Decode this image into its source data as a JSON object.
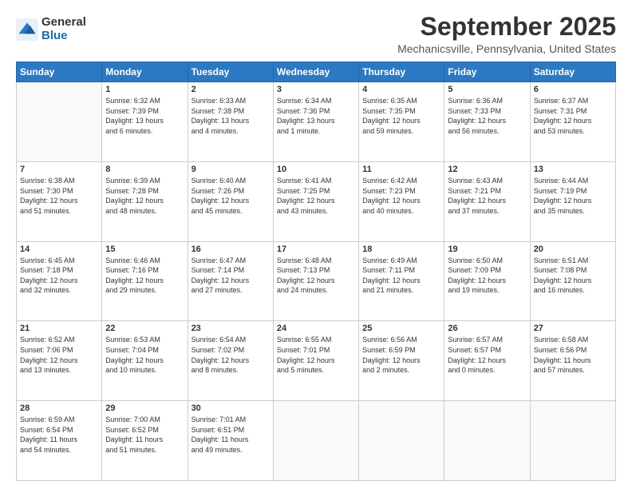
{
  "logo": {
    "general": "General",
    "blue": "Blue"
  },
  "title": {
    "month": "September 2025",
    "location": "Mechanicsville, Pennsylvania, United States"
  },
  "weekdays": [
    "Sunday",
    "Monday",
    "Tuesday",
    "Wednesday",
    "Thursday",
    "Friday",
    "Saturday"
  ],
  "weeks": [
    [
      {
        "day": "",
        "info": ""
      },
      {
        "day": "1",
        "info": "Sunrise: 6:32 AM\nSunset: 7:39 PM\nDaylight: 13 hours\nand 6 minutes."
      },
      {
        "day": "2",
        "info": "Sunrise: 6:33 AM\nSunset: 7:38 PM\nDaylight: 13 hours\nand 4 minutes."
      },
      {
        "day": "3",
        "info": "Sunrise: 6:34 AM\nSunset: 7:36 PM\nDaylight: 13 hours\nand 1 minute."
      },
      {
        "day": "4",
        "info": "Sunrise: 6:35 AM\nSunset: 7:35 PM\nDaylight: 12 hours\nand 59 minutes."
      },
      {
        "day": "5",
        "info": "Sunrise: 6:36 AM\nSunset: 7:33 PM\nDaylight: 12 hours\nand 56 minutes."
      },
      {
        "day": "6",
        "info": "Sunrise: 6:37 AM\nSunset: 7:31 PM\nDaylight: 12 hours\nand 53 minutes."
      }
    ],
    [
      {
        "day": "7",
        "info": "Sunrise: 6:38 AM\nSunset: 7:30 PM\nDaylight: 12 hours\nand 51 minutes."
      },
      {
        "day": "8",
        "info": "Sunrise: 6:39 AM\nSunset: 7:28 PM\nDaylight: 12 hours\nand 48 minutes."
      },
      {
        "day": "9",
        "info": "Sunrise: 6:40 AM\nSunset: 7:26 PM\nDaylight: 12 hours\nand 45 minutes."
      },
      {
        "day": "10",
        "info": "Sunrise: 6:41 AM\nSunset: 7:25 PM\nDaylight: 12 hours\nand 43 minutes."
      },
      {
        "day": "11",
        "info": "Sunrise: 6:42 AM\nSunset: 7:23 PM\nDaylight: 12 hours\nand 40 minutes."
      },
      {
        "day": "12",
        "info": "Sunrise: 6:43 AM\nSunset: 7:21 PM\nDaylight: 12 hours\nand 37 minutes."
      },
      {
        "day": "13",
        "info": "Sunrise: 6:44 AM\nSunset: 7:19 PM\nDaylight: 12 hours\nand 35 minutes."
      }
    ],
    [
      {
        "day": "14",
        "info": "Sunrise: 6:45 AM\nSunset: 7:18 PM\nDaylight: 12 hours\nand 32 minutes."
      },
      {
        "day": "15",
        "info": "Sunrise: 6:46 AM\nSunset: 7:16 PM\nDaylight: 12 hours\nand 29 minutes."
      },
      {
        "day": "16",
        "info": "Sunrise: 6:47 AM\nSunset: 7:14 PM\nDaylight: 12 hours\nand 27 minutes."
      },
      {
        "day": "17",
        "info": "Sunrise: 6:48 AM\nSunset: 7:13 PM\nDaylight: 12 hours\nand 24 minutes."
      },
      {
        "day": "18",
        "info": "Sunrise: 6:49 AM\nSunset: 7:11 PM\nDaylight: 12 hours\nand 21 minutes."
      },
      {
        "day": "19",
        "info": "Sunrise: 6:50 AM\nSunset: 7:09 PM\nDaylight: 12 hours\nand 19 minutes."
      },
      {
        "day": "20",
        "info": "Sunrise: 6:51 AM\nSunset: 7:08 PM\nDaylight: 12 hours\nand 16 minutes."
      }
    ],
    [
      {
        "day": "21",
        "info": "Sunrise: 6:52 AM\nSunset: 7:06 PM\nDaylight: 12 hours\nand 13 minutes."
      },
      {
        "day": "22",
        "info": "Sunrise: 6:53 AM\nSunset: 7:04 PM\nDaylight: 12 hours\nand 10 minutes."
      },
      {
        "day": "23",
        "info": "Sunrise: 6:54 AM\nSunset: 7:02 PM\nDaylight: 12 hours\nand 8 minutes."
      },
      {
        "day": "24",
        "info": "Sunrise: 6:55 AM\nSunset: 7:01 PM\nDaylight: 12 hours\nand 5 minutes."
      },
      {
        "day": "25",
        "info": "Sunrise: 6:56 AM\nSunset: 6:59 PM\nDaylight: 12 hours\nand 2 minutes."
      },
      {
        "day": "26",
        "info": "Sunrise: 6:57 AM\nSunset: 6:57 PM\nDaylight: 12 hours\nand 0 minutes."
      },
      {
        "day": "27",
        "info": "Sunrise: 6:58 AM\nSunset: 6:56 PM\nDaylight: 11 hours\nand 57 minutes."
      }
    ],
    [
      {
        "day": "28",
        "info": "Sunrise: 6:59 AM\nSunset: 6:54 PM\nDaylight: 11 hours\nand 54 minutes."
      },
      {
        "day": "29",
        "info": "Sunrise: 7:00 AM\nSunset: 6:52 PM\nDaylight: 11 hours\nand 51 minutes."
      },
      {
        "day": "30",
        "info": "Sunrise: 7:01 AM\nSunset: 6:51 PM\nDaylight: 11 hours\nand 49 minutes."
      },
      {
        "day": "",
        "info": ""
      },
      {
        "day": "",
        "info": ""
      },
      {
        "day": "",
        "info": ""
      },
      {
        "day": "",
        "info": ""
      }
    ]
  ]
}
